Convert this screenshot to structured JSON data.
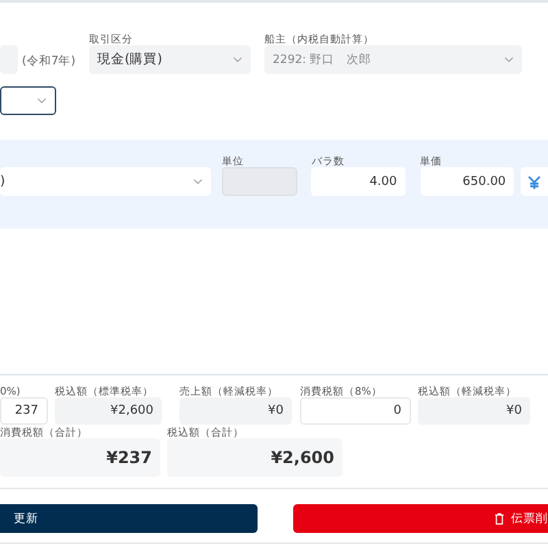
{
  "header": {
    "era": "(令和7年)",
    "fields": [
      {
        "label": "取引区分",
        "value": "現金(購買)",
        "disabled": false
      },
      {
        "label": "船主（内税自動計算）",
        "value": "2292: 野口　次郎",
        "disabled": true
      }
    ]
  },
  "line": {
    "item_value": ")",
    "fields": [
      {
        "label": "単位",
        "kind": "readonly"
      },
      {
        "label": "バラ数",
        "value": "4.00",
        "kind": "input"
      },
      {
        "label": "単価",
        "value": "650.00",
        "kind": "input"
      }
    ]
  },
  "totals": {
    "fields": [
      {
        "label": "0%)",
        "value": "237",
        "kind": "input"
      },
      {
        "label": "税込額（標準税率）",
        "value": "¥2,600",
        "kind": "readonly"
      },
      {
        "label": "売上額（軽減税率）",
        "value": "¥0",
        "kind": "readonly"
      },
      {
        "label": "消費税額（8%）",
        "value": "0",
        "kind": "input"
      },
      {
        "label": "税込額（軽減税率）",
        "value": "¥0",
        "kind": "readonly"
      }
    ],
    "sums": [
      {
        "label": "消費税額（合計）",
        "value": "¥237"
      },
      {
        "label": "税込額（合計）",
        "value": "¥2,600"
      }
    ]
  },
  "buttons": {
    "update": "更新",
    "delete": "伝票削"
  }
}
